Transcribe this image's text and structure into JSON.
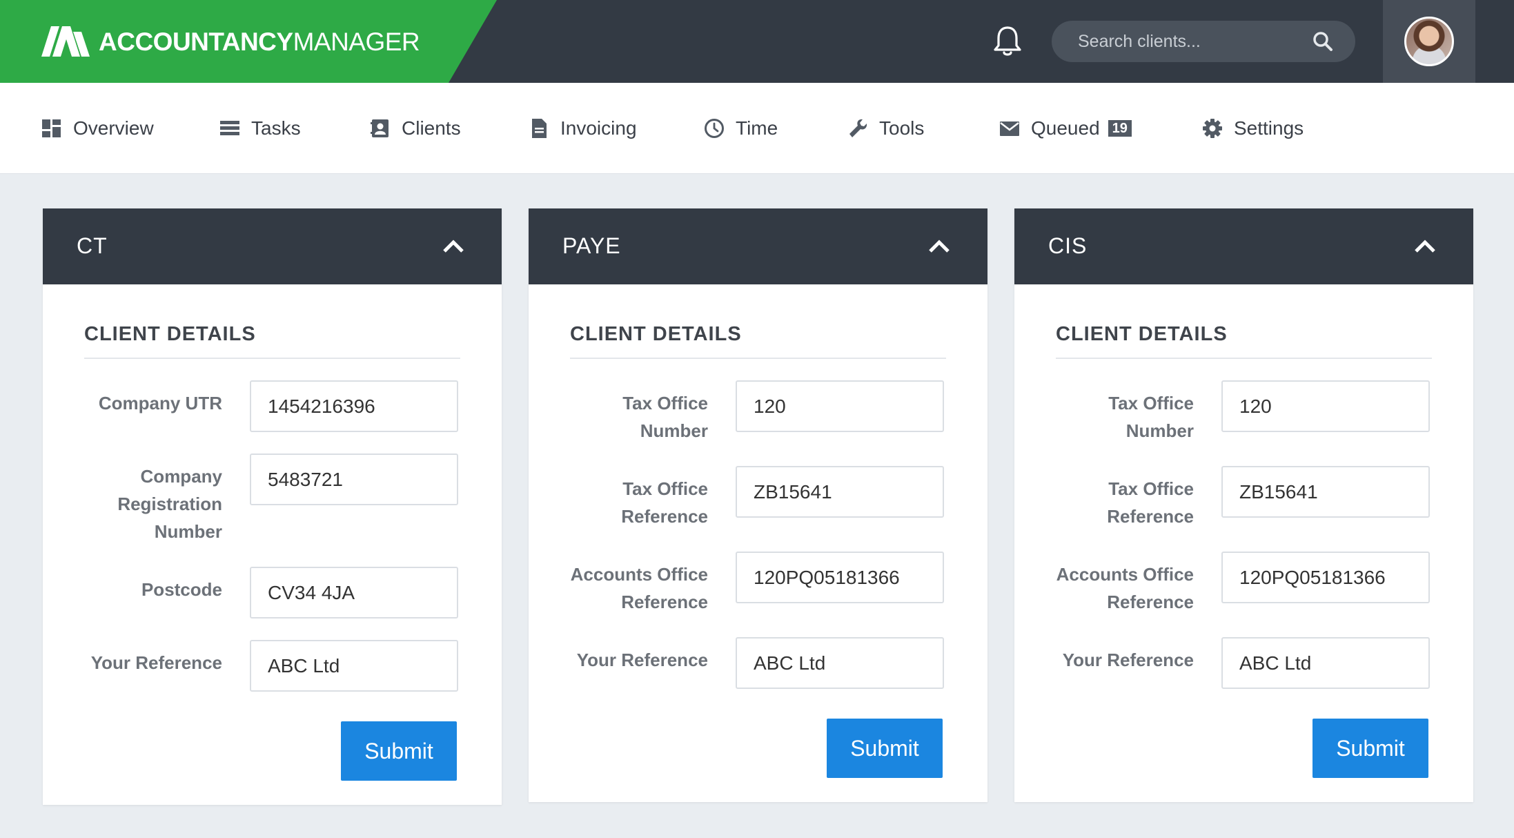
{
  "brand": {
    "name_bold": "ACCOUNTANCY",
    "name_light": "MANAGER"
  },
  "header": {
    "search_placeholder": "Search clients..."
  },
  "nav": [
    {
      "label": "Overview",
      "icon": "dashboard-icon"
    },
    {
      "label": "Tasks",
      "icon": "list-icon"
    },
    {
      "label": "Clients",
      "icon": "contact-card-icon"
    },
    {
      "label": "Invoicing",
      "icon": "document-icon"
    },
    {
      "label": "Time",
      "icon": "clock-icon"
    },
    {
      "label": "Tools",
      "icon": "wrench-icon"
    },
    {
      "label": "Queued",
      "icon": "envelope-icon",
      "badge": "19"
    },
    {
      "label": "Settings",
      "icon": "gear-icon"
    }
  ],
  "cards": [
    {
      "title": "CT",
      "section": "CLIENT DETAILS",
      "fields": [
        {
          "label": "Company UTR",
          "value": "1454216396"
        },
        {
          "label": "Company Registration Number",
          "value": "5483721"
        },
        {
          "label": "Postcode",
          "value": "CV34 4JA"
        },
        {
          "label": "Your Reference",
          "value": "ABC Ltd"
        }
      ],
      "submit": "Submit"
    },
    {
      "title": "PAYE",
      "section": "CLIENT DETAILS",
      "fields": [
        {
          "label": "Tax Office Number",
          "value": "120"
        },
        {
          "label": "Tax Office Reference",
          "value": "ZB15641"
        },
        {
          "label": "Accounts Office Reference",
          "value": "120PQ05181366"
        },
        {
          "label": "Your Reference",
          "value": "ABC Ltd"
        }
      ],
      "submit": "Submit"
    },
    {
      "title": "CIS",
      "section": "CLIENT DETAILS",
      "fields": [
        {
          "label": "Tax Office Number",
          "value": "120"
        },
        {
          "label": "Tax Office Reference",
          "value": "ZB15641"
        },
        {
          "label": "Accounts Office Reference",
          "value": "120PQ05181366"
        },
        {
          "label": "Your Reference",
          "value": "ABC Ltd"
        }
      ],
      "submit": "Submit"
    }
  ],
  "colors": {
    "brand_green": "#2eaa46",
    "header_dark": "#333a44",
    "primary_button": "#1b86e0"
  }
}
